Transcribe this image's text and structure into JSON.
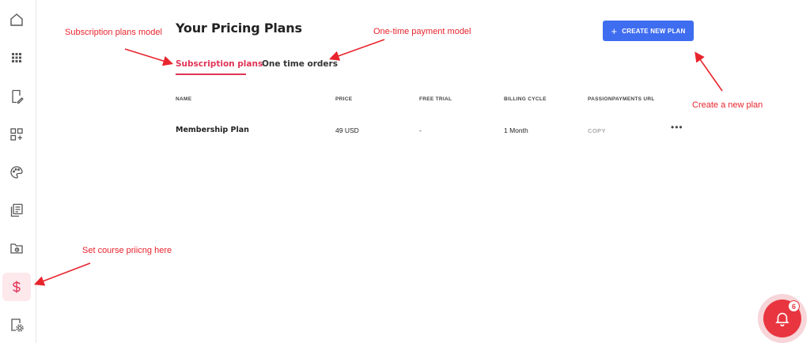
{
  "page": {
    "title": "Your Pricing Plans",
    "create_button_label": "CREATE NEW PLAN",
    "tabs": [
      {
        "label": "Subscription plans",
        "active": true
      },
      {
        "label": "One time orders",
        "active": false
      }
    ],
    "table": {
      "headers": [
        "NAME",
        "PRICE",
        "FREE TRIAL",
        "BILLING CYCLE",
        "PASSIONPAYMENTS URL"
      ],
      "rows": [
        {
          "name": "Membership Plan",
          "price": "49 USD",
          "free_trial": "-",
          "billing_cycle": "1 Month",
          "url_action": "COPY",
          "more": "•••"
        }
      ]
    }
  },
  "sidebar": {
    "items": [
      {
        "icon": "home-icon"
      },
      {
        "icon": "apps-grid-icon"
      },
      {
        "icon": "edit-document-icon"
      },
      {
        "icon": "add-widget-icon"
      },
      {
        "icon": "palette-icon"
      },
      {
        "icon": "content-pages-icon"
      },
      {
        "icon": "folder-icon"
      },
      {
        "icon": "dollar-icon",
        "active": true
      },
      {
        "icon": "settings-document-icon"
      }
    ]
  },
  "annotations": {
    "subscription": "Subscription plans model",
    "one_time": "One-time payment model",
    "create_plan": "Create a new plan",
    "course_pricing": "Set course priicng here"
  },
  "notifications": {
    "count": "6"
  },
  "colors": {
    "accent": "#e03355",
    "button": "#3f6df0",
    "annotation": "#e8242d"
  }
}
